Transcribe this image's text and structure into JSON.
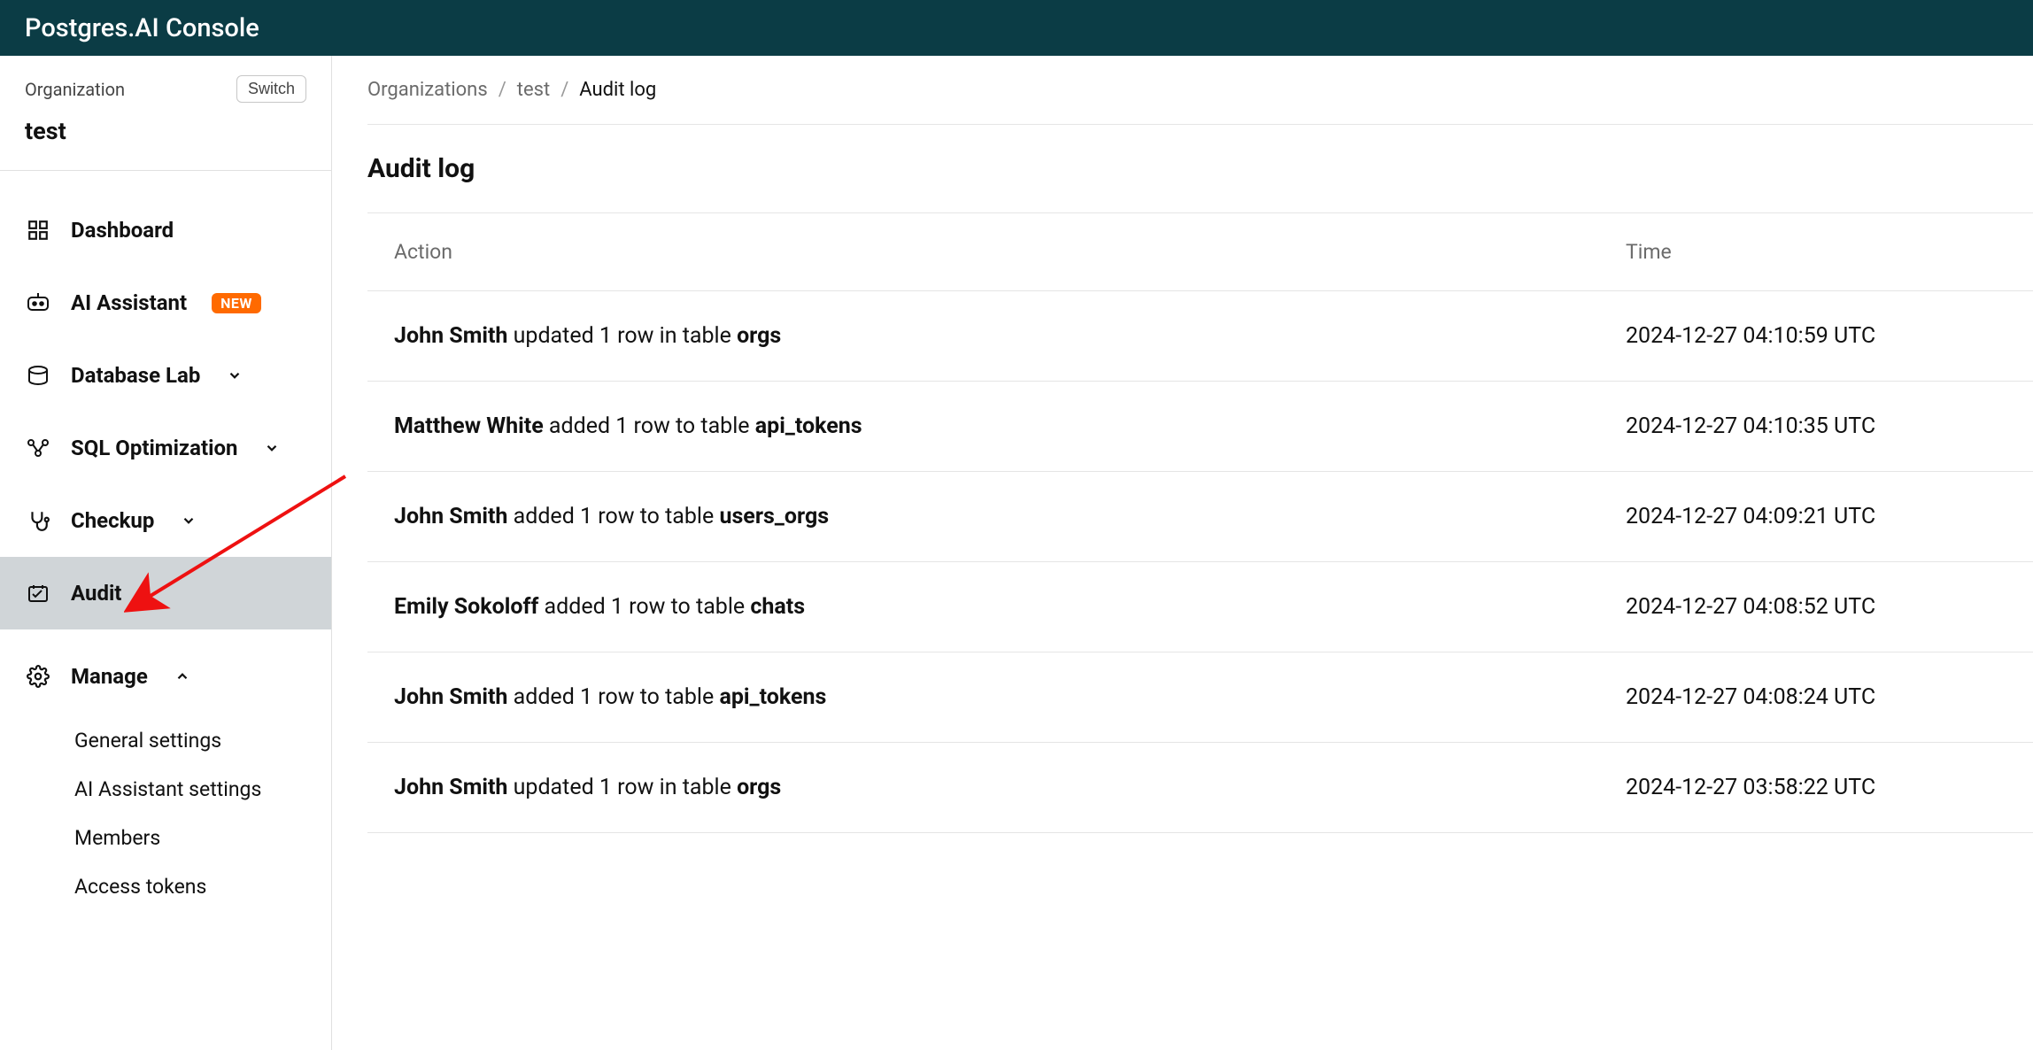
{
  "header": {
    "title": "Postgres.AI Console"
  },
  "org": {
    "label": "Organization",
    "name": "test",
    "switch_label": "Switch"
  },
  "sidebar": {
    "dashboard": "Dashboard",
    "ai_assistant": "AI Assistant",
    "new_badge": "NEW",
    "database_lab": "Database Lab",
    "sql_optimization": "SQL Optimization",
    "checkup": "Checkup",
    "audit": "Audit",
    "manage": "Manage",
    "manage_items": {
      "general": "General settings",
      "ai": "AI Assistant settings",
      "members": "Members",
      "tokens": "Access tokens"
    }
  },
  "breadcrumb": {
    "organizations": "Organizations",
    "org": "test",
    "current": "Audit log"
  },
  "page": {
    "title": "Audit log"
  },
  "table": {
    "headers": {
      "action": "Action",
      "time": "Time"
    },
    "rows": [
      {
        "actor": "John Smith",
        "verb": " updated 1 row in table ",
        "target": "orgs",
        "time": "2024-12-27 04:10:59 UTC"
      },
      {
        "actor": "Matthew White",
        "verb": " added 1 row to table ",
        "target": "api_tokens",
        "time": "2024-12-27 04:10:35 UTC"
      },
      {
        "actor": "John Smith",
        "verb": " added 1 row to table ",
        "target": "users_orgs",
        "time": "2024-12-27 04:09:21 UTC"
      },
      {
        "actor": "Emily Sokoloff",
        "verb": " added 1 row to table ",
        "target": "chats",
        "time": "2024-12-27 04:08:52 UTC"
      },
      {
        "actor": "John Smith",
        "verb": " added 1 row to table ",
        "target": "api_tokens",
        "time": "2024-12-27 04:08:24 UTC"
      },
      {
        "actor": "John Smith",
        "verb": " updated 1 row in table ",
        "target": "orgs",
        "time": "2024-12-27 03:58:22 UTC"
      }
    ]
  }
}
